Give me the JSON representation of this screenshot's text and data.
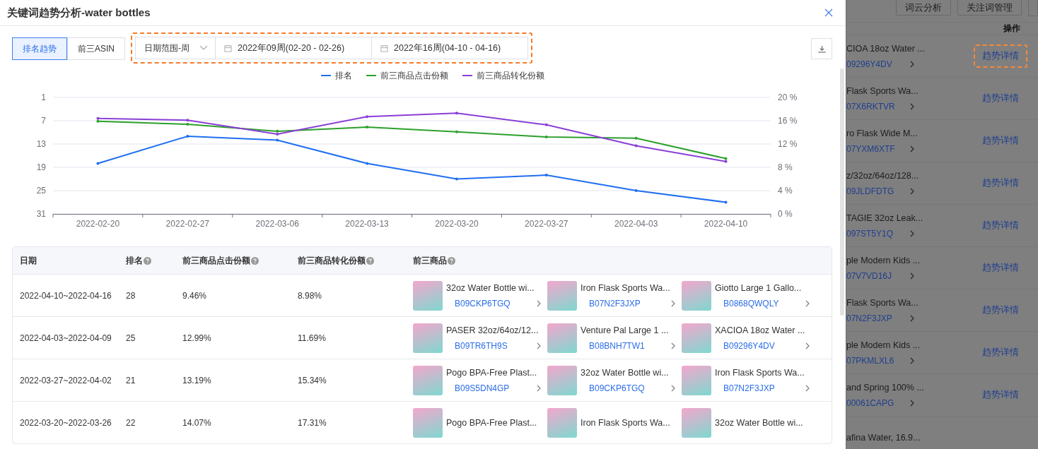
{
  "dialog": {
    "title": "关键词趋势分析-water bottles"
  },
  "toolbar": {
    "view_tabs": [
      {
        "label": "排名趋势",
        "selected": true
      },
      {
        "label": "前三ASIN",
        "selected": false
      }
    ],
    "range_select": "日期范围-周",
    "start_week": "2022年09周(02-20 - 02-26)",
    "end_week": "2022年16周(04-10 - 04-16)",
    "highlighted": true
  },
  "chart": {
    "chart_data": {
      "type": "line",
      "categories": [
        "2022-02-20",
        "2022-02-27",
        "2022-03-06",
        "2022-03-13",
        "2022-03-20",
        "2022-03-27",
        "2022-04-03",
        "2022-04-10"
      ],
      "grid": true,
      "ylim": [
        31,
        1
      ],
      "yticks": [
        1,
        7,
        13,
        19,
        25,
        31
      ],
      "y2lim": [
        0,
        20
      ],
      "y2ticks": [
        {
          "value": 0,
          "label": "0 %"
        },
        {
          "value": 4,
          "label": "4 %"
        },
        {
          "value": 8,
          "label": "8 %"
        },
        {
          "value": 12,
          "label": "12 %"
        },
        {
          "value": 16,
          "label": "16 %"
        },
        {
          "value": 20,
          "label": "20 %"
        }
      ],
      "series": [
        {
          "name": "排名",
          "color": "#1f6ff0",
          "values": [
            18,
            11,
            12,
            18,
            22,
            21,
            25,
            28
          ]
        },
        {
          "name": "前三商品点击份额",
          "color": "#2ca02c",
          "axis": "y2",
          "values": [
            15.9,
            15.4,
            14.2,
            14.9,
            14.1,
            13.2,
            13,
            9.5
          ]
        },
        {
          "name": "前三商品转化份额",
          "color": "#8a3fd6",
          "axis": "y2",
          "values": [
            16.4,
            16.1,
            13.7,
            16.7,
            17.3,
            15.3,
            11.7,
            9
          ]
        }
      ]
    }
  },
  "table": {
    "columns": [
      {
        "label": "日期",
        "help": false
      },
      {
        "label": "排名",
        "help": true
      },
      {
        "label": "前三商品点击份额",
        "help": true
      },
      {
        "label": "前三商品转化份额",
        "help": true
      },
      {
        "label": "前三商品",
        "help": true
      }
    ],
    "rows": [
      {
        "date": "2022-04-10~2022-04-16",
        "rank": "28",
        "click_share": "9.46%",
        "conversion_share": "8.98%",
        "products": [
          {
            "title": "32oz Water Bottle wi...",
            "asin": "B09CKP6TGQ"
          },
          {
            "title": "Iron Flask Sports Wa...",
            "asin": "B07N2F3JXP"
          },
          {
            "title": "Giotto Large 1 Gallo...",
            "asin": "B0868QWQLY"
          }
        ]
      },
      {
        "date": "2022-04-03~2022-04-09",
        "rank": "25",
        "click_share": "12.99%",
        "conversion_share": "11.69%",
        "products": [
          {
            "title": "PASER 32oz/64oz/12...",
            "asin": "B09TR6TH9S"
          },
          {
            "title": "Venture Pal Large 1 ...",
            "asin": "B08BNH7TW1"
          },
          {
            "title": "XACIOA 18oz Water ...",
            "asin": "B09296Y4DV"
          }
        ]
      },
      {
        "date": "2022-03-27~2022-04-02",
        "rank": "21",
        "click_share": "13.19%",
        "conversion_share": "15.34%",
        "products": [
          {
            "title": "Pogo BPA-Free Plast...",
            "asin": "B09S5DN4GP"
          },
          {
            "title": "32oz Water Bottle wi...",
            "asin": "B09CKP6TGQ"
          },
          {
            "title": "Iron Flask Sports Wa...",
            "asin": "B07N2F3JXP"
          }
        ]
      },
      {
        "date": "2022-03-20~2022-03-26",
        "rank": "22",
        "click_share": "14.07%",
        "conversion_share": "17.31%",
        "products": [
          {
            "title": "Pogo BPA-Free Plast..."
          },
          {
            "title": "Iron Flask Sports Wa..."
          },
          {
            "title": "32oz Water Bottle wi..."
          }
        ]
      }
    ]
  },
  "background_page": {
    "buttons": [
      "词云分析",
      "关注词管理"
    ],
    "action_header": "操作",
    "rows": [
      {
        "product": "CIOA 18oz Water ...",
        "asin": "09296Y4DV",
        "action": "趋势详情",
        "highlighted": true
      },
      {
        "product": "Flask Sports Wa...",
        "asin": "07X6RKTVR",
        "action": "趋势详情",
        "highlighted": false
      },
      {
        "product": "ro Flask Wide M...",
        "asin": "07YXM6XTF",
        "action": "趋势详情",
        "highlighted": false
      },
      {
        "product": "z/32oz/64oz/128...",
        "asin": "09JLDFDTG",
        "action": "趋势详情",
        "highlighted": false
      },
      {
        "product": "TAGIE 32oz Leak...",
        "asin": "097ST5Y1Q",
        "action": "趋势详情",
        "highlighted": false
      },
      {
        "product": "ple Modern Kids ...",
        "asin": "07V7VD16J",
        "action": "趋势详情",
        "highlighted": false
      },
      {
        "product": "Flask Sports Wa...",
        "asin": "07N2F3JXP",
        "action": "趋势详情",
        "highlighted": false
      },
      {
        "product": "ple Modern Kids ...",
        "asin": "07PKMLXL6",
        "action": "趋势详情",
        "highlighted": false
      },
      {
        "product": "and Spring 100% ...",
        "asin": "00061CAPG",
        "action": "趋势详情",
        "highlighted": false
      },
      {
        "product": "afina Water, 16.9..."
      }
    ]
  }
}
